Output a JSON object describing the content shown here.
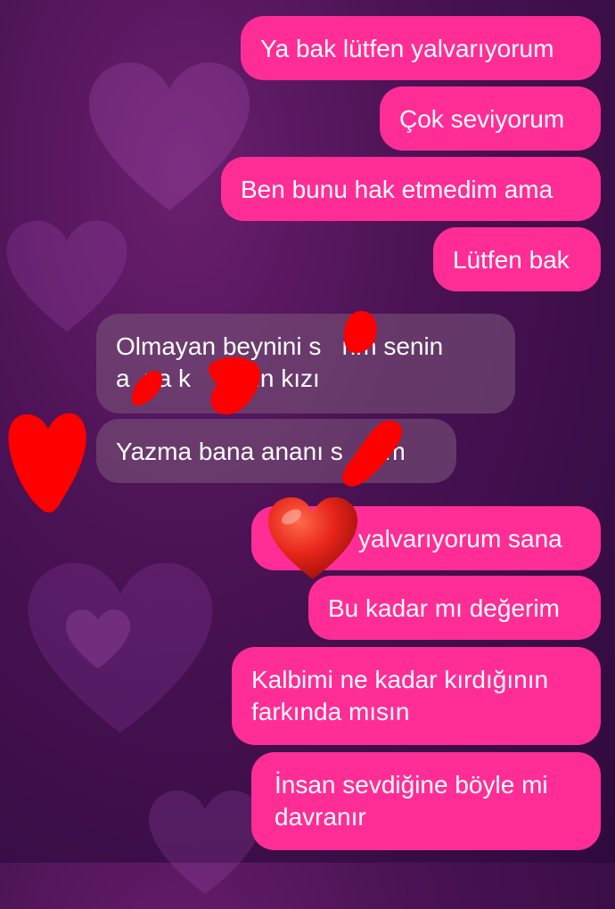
{
  "chat": {
    "messages": [
      {
        "direction": "outgoing",
        "text": "Ya bak lütfen yalvarıyorum"
      },
      {
        "direction": "outgoing",
        "text": "Çok seviyorum"
      },
      {
        "direction": "outgoing",
        "text": "Ben bunu hak etmedim ama"
      },
      {
        "direction": "outgoing",
        "text": "Lütfen bak"
      },
      {
        "direction": "incoming",
        "text": "Olmayan beynini s   rim senin\na  na k     mun kızı"
      },
      {
        "direction": "incoming",
        "text": "Yazma bana ananı s     ım"
      },
      {
        "direction": "outgoing",
        "text": "yalvarıyorum sana"
      },
      {
        "direction": "outgoing",
        "text": "Bu kadar mı değerim"
      },
      {
        "direction": "outgoing",
        "text": "Kalbimi ne kadar kırdığının\nfarkında mısın"
      },
      {
        "direction": "outgoing",
        "text": "İnsan sevdiğine böyle mi\ndavranır"
      }
    ]
  },
  "colors": {
    "outgoing_bubble": "#ff2d95",
    "incoming_bubble": "#6e4a72",
    "redaction": "#ff0000"
  },
  "overlay": {
    "sticker_emoji": "❤️"
  }
}
